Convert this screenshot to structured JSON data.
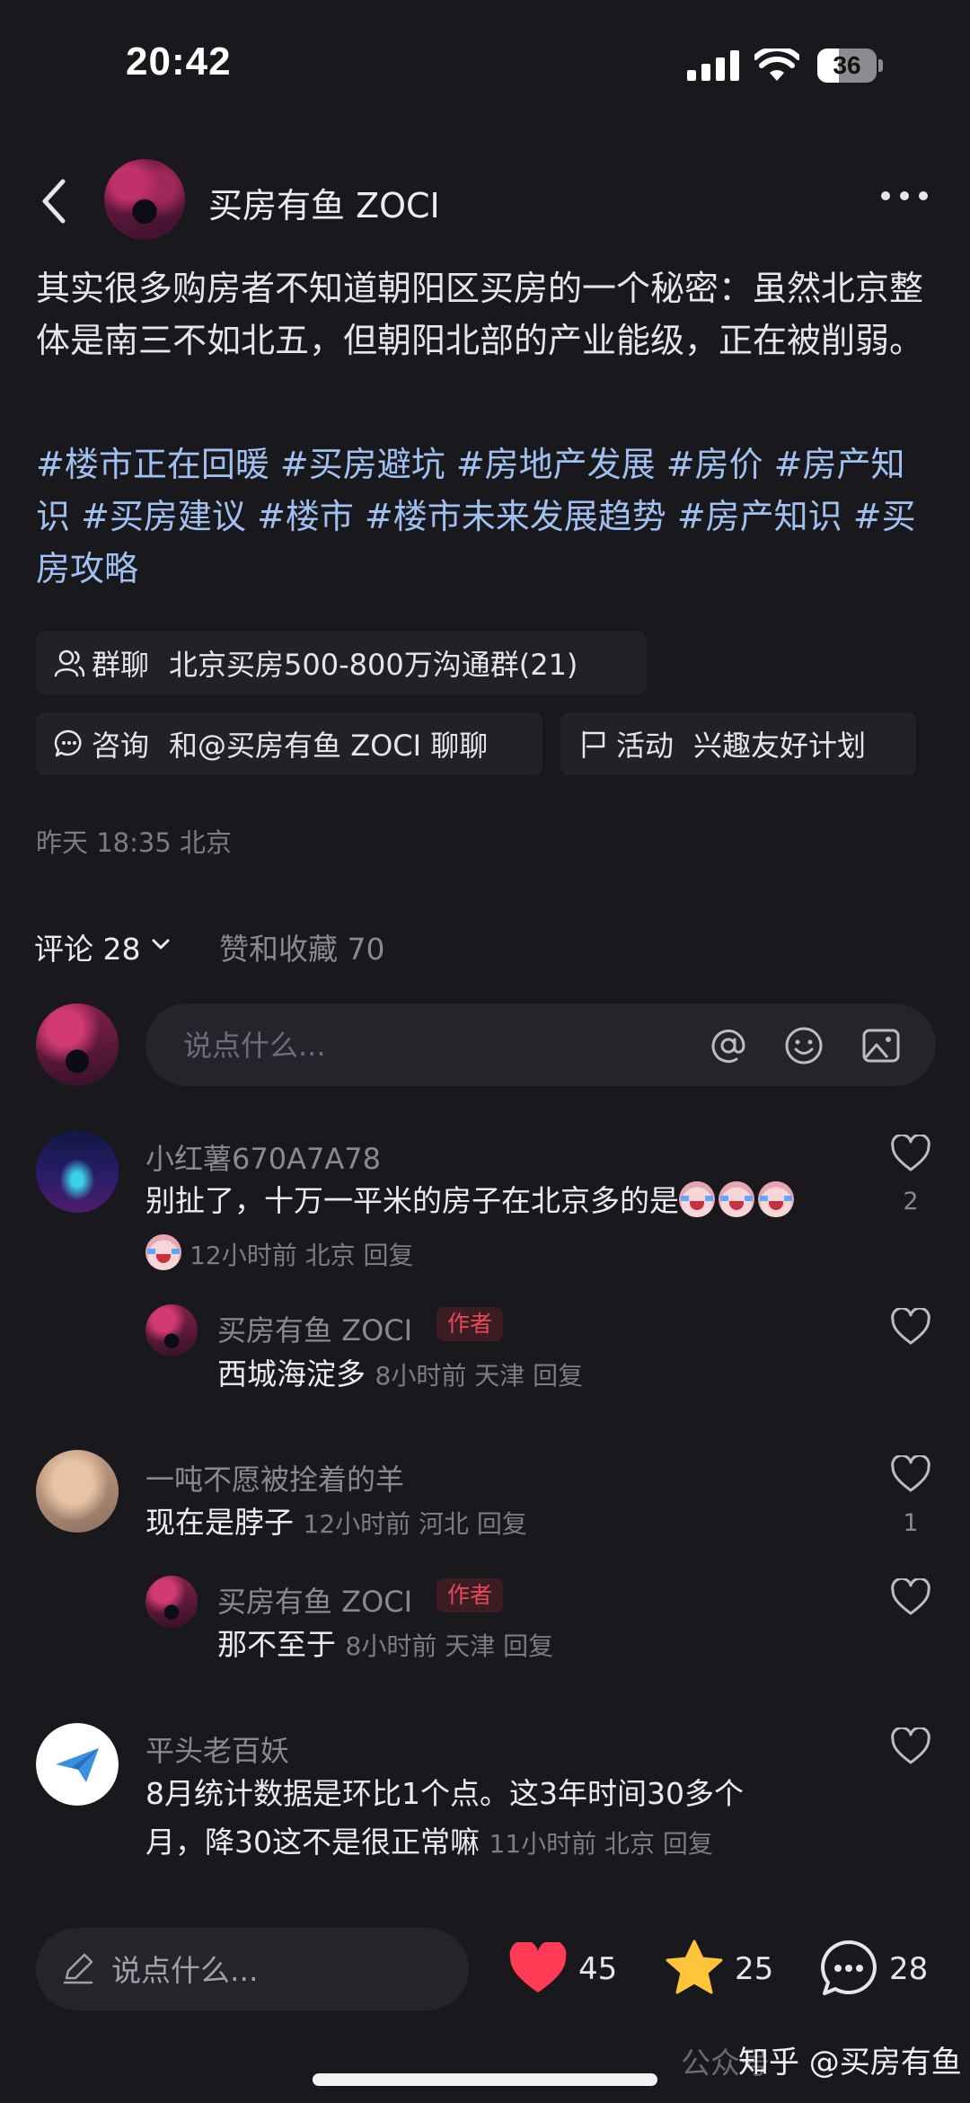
{
  "status_bar": {
    "time": "20:42",
    "battery": "36"
  },
  "header": {
    "author_name": "买房有鱼 ZOCI"
  },
  "post": {
    "text": "其实很多购房者不知道朝阳区买房的一个秘密：虽然北京整体是南三不如北五，但朝阳北部的产业能级，正在被削弱。",
    "tags_line1": "#楼市正在回暖 #买房避坑 #房地产发展 #房价 #房产知",
    "tags_line2": "识 #买房建议 #楼市 #楼市未来发展趋势 #房产知识 #买",
    "tags_line3": "房攻略",
    "chips": {
      "group_kind": "群聊",
      "group_text": "北京买房500-800万沟通群(21)",
      "consult_kind": "咨询",
      "consult_text": "和@买房有鱼 ZOCI 聊聊",
      "activity_kind": "活动",
      "activity_text": "兴趣友好计划"
    },
    "meta": "昨天 18:35 北京"
  },
  "tabs": {
    "comments": "评论 28",
    "likes_collects": "赞和收藏 70"
  },
  "comment_input": {
    "placeholder": "说点什么..."
  },
  "comments": [
    {
      "name": "小红薯670A7A78",
      "text": "别扯了，十万一平米的房子在北京多的是",
      "meta": "12小时前 北京 回复",
      "likes": "2"
    },
    {
      "name": "买房有鱼 ZOCI",
      "badge": "作者",
      "text": "西城海淀多",
      "meta": "8小时前 天津 回复"
    },
    {
      "name": "一吨不愿被拴着的羊",
      "text": "现在是脖子",
      "meta": "12小时前 河北 回复",
      "likes": "1"
    },
    {
      "name": "买房有鱼 ZOCI",
      "badge": "作者",
      "text": "那不至于",
      "meta": "8小时前 天津 回复"
    },
    {
      "name": "平头老百妖",
      "text_line1": "8月统计数据是环比1个点。这3年时间30多个",
      "text_line2": "月，降30这不是很正常嘛",
      "meta": "11小时前 北京 回复"
    }
  ],
  "bottom_bar": {
    "placeholder": "说点什么...",
    "likes": "45",
    "stars": "25",
    "comments": "28"
  },
  "watermark": {
    "text": "知乎 @买房有鱼",
    "faint": "公众号"
  },
  "colors": {
    "background": "#19181d",
    "tag": "#9fc0f0",
    "like_red": "#ff3b55",
    "star_yellow": "#ffc53a",
    "badge_red": "#e8485c"
  }
}
